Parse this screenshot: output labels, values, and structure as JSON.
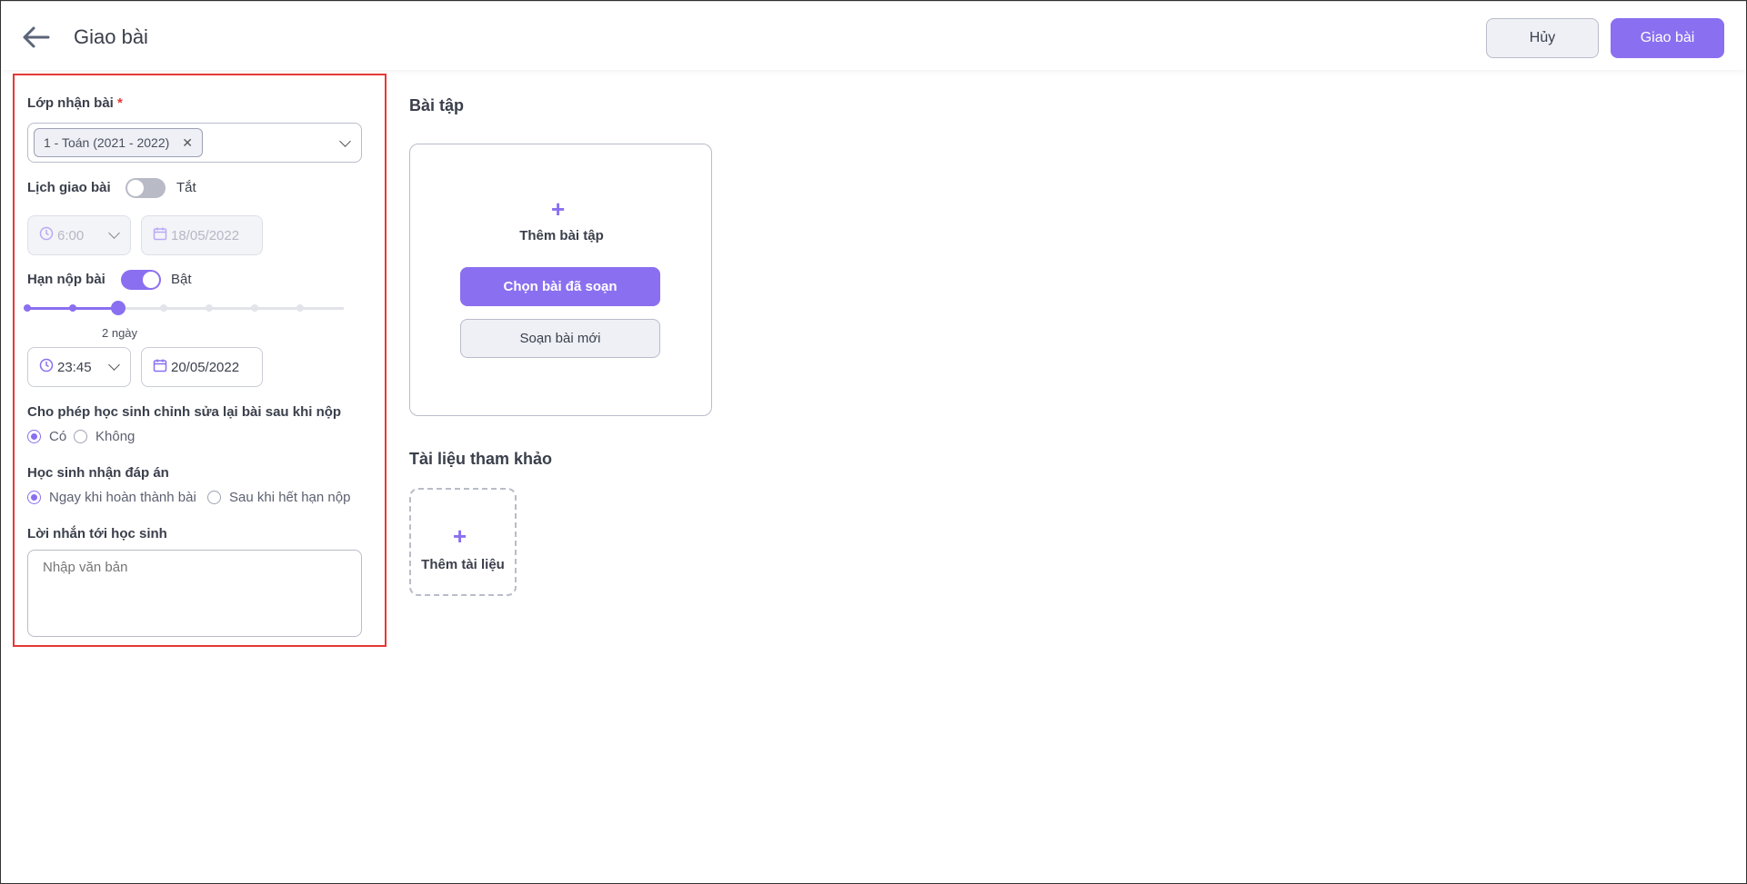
{
  "header": {
    "title": "Giao bài",
    "cancel_label": "Hủy",
    "assign_label": "Giao bài"
  },
  "form": {
    "class_label": "Lớp nhận bài",
    "required_mark": "*",
    "class_chip": "1 - Toán (2021 - 2022)",
    "schedule_label": "Lịch giao bài",
    "schedule_toggle_state": "Tắt",
    "schedule_time": "6:00",
    "schedule_date": "18/05/2022",
    "deadline_label": "Hạn nộp bài",
    "deadline_toggle_state": "Bật",
    "deadline_slider_value": "2 ngày",
    "deadline_slider_step": 2,
    "deadline_slider_steps": 7,
    "deadline_time": "23:45",
    "deadline_date": "20/05/2022",
    "edit_label": "Cho phép học sinh chỉnh sửa lại bài sau khi nộp",
    "edit_options": [
      "Có",
      "Không"
    ],
    "answer_label": "Học sinh nhận đáp án",
    "answer_options": [
      "Ngay khi hoàn thành bài",
      "Sau khi hết hạn nộp"
    ],
    "message_label": "Lời nhắn tới học sinh",
    "message_placeholder": "Nhập văn bản"
  },
  "exercise": {
    "section_title": "Bài tập",
    "add_label": "Thêm bài tập",
    "choose_label": "Chọn bài đã soạn",
    "compose_label": "Soạn bài mới"
  },
  "documents": {
    "section_title": "Tài liệu tham khảo",
    "add_label": "Thêm tài liệu"
  },
  "colors": {
    "accent": "#8a6ff0",
    "highlight_border": "#e53935"
  }
}
